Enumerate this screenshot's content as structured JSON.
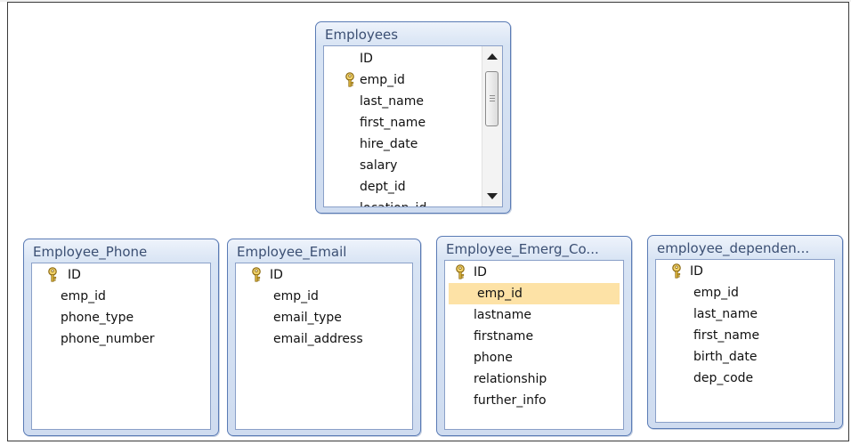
{
  "tables": [
    {
      "title": "Employees",
      "fields": [
        {
          "name": "ID",
          "key": false
        },
        {
          "name": "emp_id",
          "key": true
        },
        {
          "name": "last_name",
          "key": false
        },
        {
          "name": "first_name",
          "key": false
        },
        {
          "name": "hire_date",
          "key": false
        },
        {
          "name": "salary",
          "key": false
        },
        {
          "name": "dept_id",
          "key": false
        },
        {
          "name": "location_id",
          "key": false
        }
      ],
      "has_scrollbar": true
    },
    {
      "title": "Employee_Phone",
      "fields": [
        {
          "name": "ID",
          "key": true
        },
        {
          "name": "emp_id",
          "key": false
        },
        {
          "name": "phone_type",
          "key": false
        },
        {
          "name": "phone_number",
          "key": false
        }
      ]
    },
    {
      "title": "Employee_Email",
      "fields": [
        {
          "name": "ID",
          "key": true
        },
        {
          "name": "emp_id",
          "key": false
        },
        {
          "name": "email_type",
          "key": false
        },
        {
          "name": "email_address",
          "key": false
        }
      ]
    },
    {
      "title": "Employee_Emerg_Co...",
      "fields": [
        {
          "name": "ID",
          "key": true
        },
        {
          "name": "emp_id",
          "key": false,
          "selected": true
        },
        {
          "name": "lastname",
          "key": false
        },
        {
          "name": "firstname",
          "key": false
        },
        {
          "name": "phone",
          "key": false
        },
        {
          "name": "relationship",
          "key": false
        },
        {
          "name": "further_info",
          "key": false
        }
      ]
    },
    {
      "title": "employee_dependen...",
      "fields": [
        {
          "name": "ID",
          "key": true
        },
        {
          "name": "emp_id",
          "key": false
        },
        {
          "name": "last_name",
          "key": false
        },
        {
          "name": "first_name",
          "key": false
        },
        {
          "name": "birth_date",
          "key": false
        },
        {
          "name": "dep_code",
          "key": false
        }
      ]
    }
  ],
  "colors": {
    "title_text": "#3b4f73",
    "window_border": "#5a7bb5",
    "selection": "#fde2a6",
    "key_gold": "#c9a227"
  },
  "icons": {
    "primary_key": "key-icon",
    "scroll_up": "scroll-up-arrow",
    "scroll_down": "scroll-down-arrow"
  }
}
